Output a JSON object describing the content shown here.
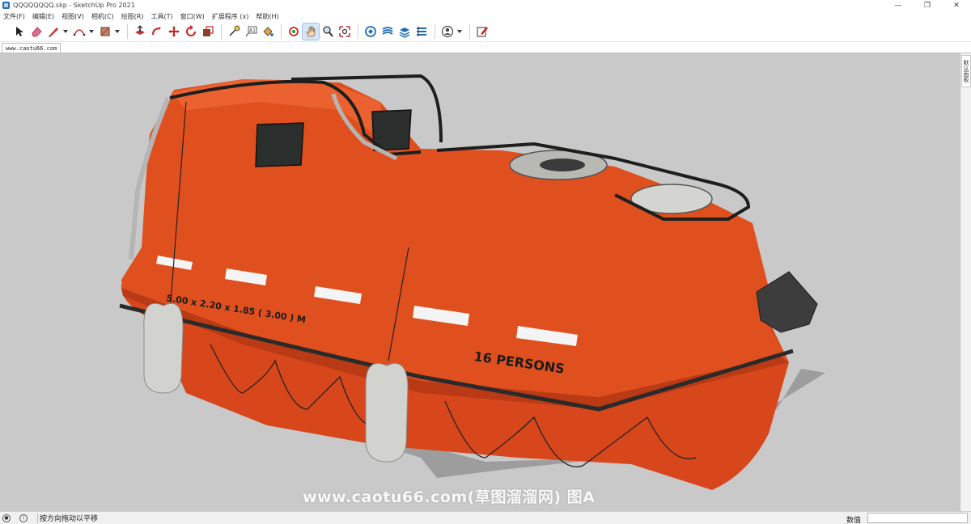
{
  "window": {
    "title": "QQQQQQQQ.skp - SketchUp Pro 2021",
    "minimize": "—",
    "restore": "❐",
    "close": "✕"
  },
  "menu": [
    "文件(F)",
    "编辑(E)",
    "视图(V)",
    "相机(C)",
    "绘图(R)",
    "工具(T)",
    "窗口(W)",
    "扩展程序 (x)",
    "帮助(H)"
  ],
  "scene_tab": "www.caotu66.com",
  "viewport": {
    "watermark": "www.caotu66.com(草图溜溜网) 图A",
    "model_text": {
      "dimensions": "5.00 x 2.20 x 1.85 ( 3.00 ) M",
      "capacity": "16 PERSONS"
    }
  },
  "right_tray": {
    "tab": "默认面板"
  },
  "status": {
    "hint": "按方向拖动以平移",
    "measurements_label": "数值",
    "measurements_value": ""
  },
  "colors": {
    "hull": "#e0501f",
    "viewport_bg": "#c9c9c9",
    "rail": "#1e1e1e",
    "fender": "#d2d2cf"
  }
}
